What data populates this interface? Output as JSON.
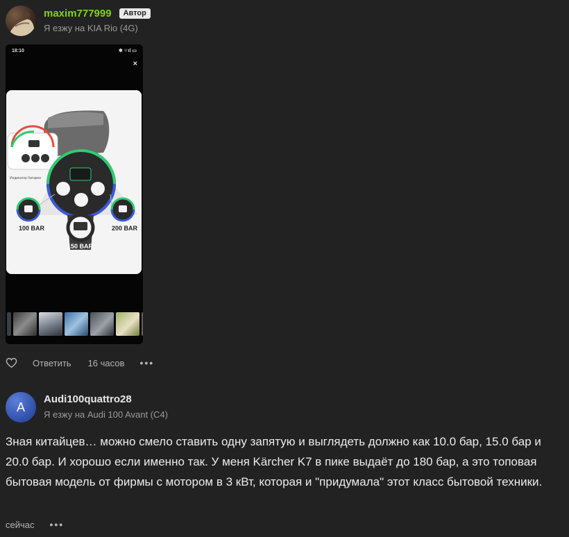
{
  "comment1": {
    "username": "maxim777999",
    "badge": "Автор",
    "car": "Я езжу на KIA Rio (4G)",
    "phone": {
      "clock": "18:10",
      "status_icons": "✱ ⁙ıl ▭",
      "close": "×",
      "product_labels": [
        "100 BAR",
        "150 BAR",
        "200 BAR"
      ],
      "battery_label": "Индикатор батареи"
    },
    "reply_label": "Ответить",
    "time": "16 часов",
    "more": "•••"
  },
  "comment2": {
    "avatar_letter": "A",
    "username": "Audi100quattro28",
    "car": "Я езжу на Audi 100 Avant (C4)",
    "text": "Зная китайцев… можно смело ставить одну запятую и выглядеть должно как 10.0 бар, 15.0 бар и 20.0 бар. И хорошо если именно так. У меня Kärcher K7 в пике выдаёт до 180 бар, а это топовая бытовая модель от фирмы с мотором в 3 кВт, которая и \"придумала\" этот класс бытовой техники.",
    "time": "сейчас",
    "more": "•••"
  },
  "colors": {
    "background": "#222222",
    "author_name": "#7ed321",
    "badge_bg": "#e9e9e9",
    "muted_text": "#9a9a9a",
    "avatar2": "#2f4ea8"
  },
  "icons": {
    "like": "heart-outline-icon",
    "more": "more-dots-icon",
    "close": "close-icon"
  }
}
